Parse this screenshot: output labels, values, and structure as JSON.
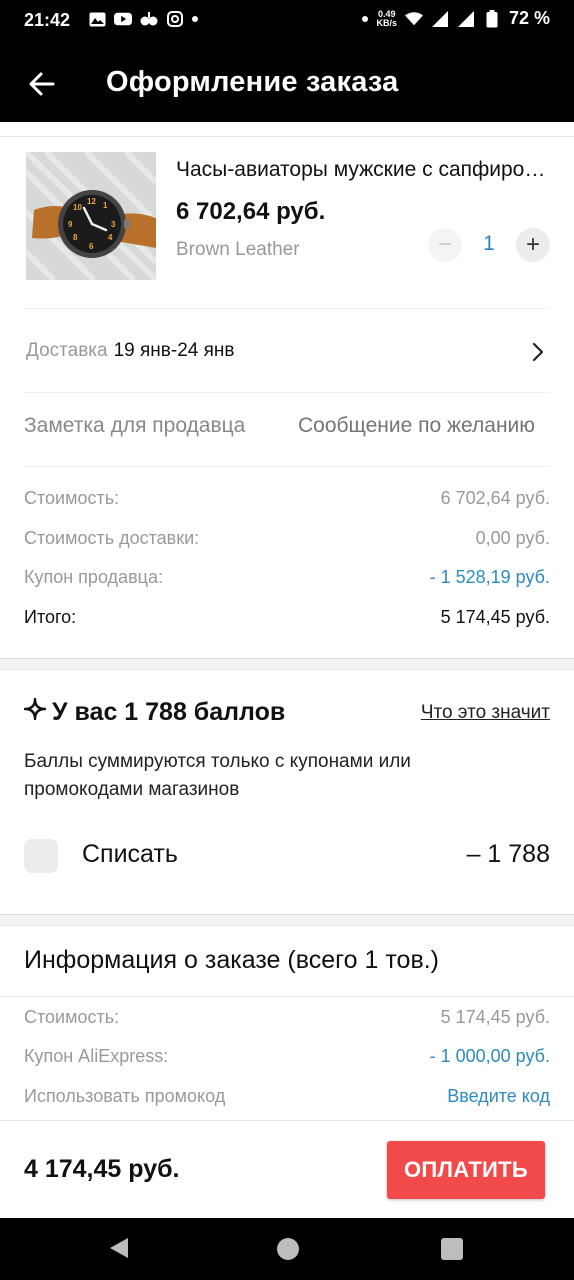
{
  "status_bar": {
    "time": "21:42",
    "net_speed_value": "0.49",
    "net_speed_unit": "KB/s",
    "battery": "72 %"
  },
  "app_bar": {
    "title": "Оформление заказа"
  },
  "product": {
    "title": "Часы-авиаторы мужские с сапфировым стеклом",
    "price": "6 702,64 руб.",
    "variant": "Brown Leather",
    "quantity": "1",
    "minus": "−",
    "plus": "+"
  },
  "delivery": {
    "label": "Доставка",
    "value": "19 янв-24 янв"
  },
  "note": {
    "label": "Заметка для продавца",
    "placeholder": "Сообщение по желанию"
  },
  "summary": [
    {
      "label": "Стоимость:",
      "value": "6 702,64 руб."
    },
    {
      "label": "Стоимость доставки:",
      "value": "0,00 руб."
    },
    {
      "label": "Купон продавца:",
      "value": "- 1 528,19 руб."
    },
    {
      "label": "Итого:",
      "value": "5 174,45 руб."
    }
  ],
  "points": {
    "title": "У вас 1 788 баллов",
    "link": "Что это значит",
    "desc": "Баллы суммируются только с купонами или промокодами магазинов",
    "spend_label": "Списать",
    "spend_value": "– 1 788"
  },
  "order_info": {
    "title": "Информация о заказе (всего 1 тов.)",
    "rows": [
      {
        "label": "Стоимость:",
        "value": "5 174,45 руб."
      },
      {
        "label": "Купон AliExpress:",
        "value": "- 1 000,00 руб."
      },
      {
        "label": "Использовать промокод",
        "value": "Введите код"
      }
    ]
  },
  "bottom": {
    "total": "4 174,45 руб.",
    "pay_label": "ОПЛАТИТЬ"
  },
  "colors": {
    "accent_blue": "#2d8bc0",
    "pay_red": "#f24a4a"
  }
}
